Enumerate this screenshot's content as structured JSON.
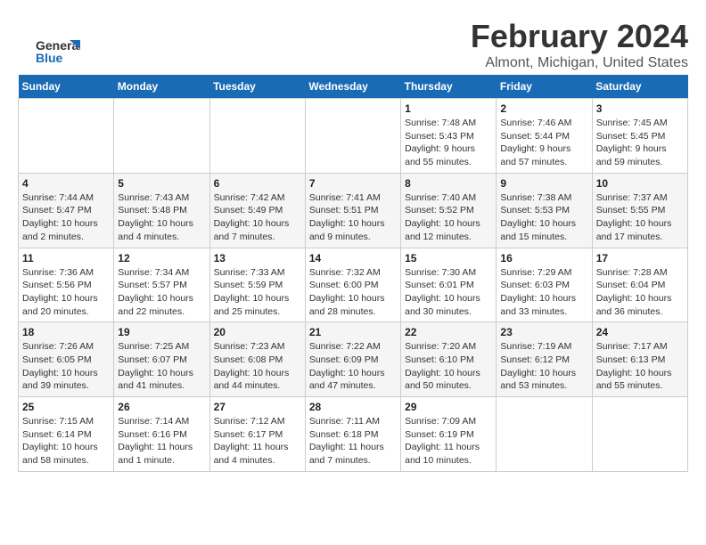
{
  "logo": {
    "line1": "General",
    "line2": "Blue"
  },
  "header": {
    "month_year": "February 2024",
    "location": "Almont, Michigan, United States"
  },
  "weekdays": [
    "Sunday",
    "Monday",
    "Tuesday",
    "Wednesday",
    "Thursday",
    "Friday",
    "Saturday"
  ],
  "weeks": [
    {
      "days": [
        {
          "number": "",
          "info": ""
        },
        {
          "number": "",
          "info": ""
        },
        {
          "number": "",
          "info": ""
        },
        {
          "number": "",
          "info": ""
        },
        {
          "number": "1",
          "info": "Sunrise: 7:48 AM\nSunset: 5:43 PM\nDaylight: 9 hours\nand 55 minutes."
        },
        {
          "number": "2",
          "info": "Sunrise: 7:46 AM\nSunset: 5:44 PM\nDaylight: 9 hours\nand 57 minutes."
        },
        {
          "number": "3",
          "info": "Sunrise: 7:45 AM\nSunset: 5:45 PM\nDaylight: 9 hours\nand 59 minutes."
        }
      ]
    },
    {
      "days": [
        {
          "number": "4",
          "info": "Sunrise: 7:44 AM\nSunset: 5:47 PM\nDaylight: 10 hours\nand 2 minutes."
        },
        {
          "number": "5",
          "info": "Sunrise: 7:43 AM\nSunset: 5:48 PM\nDaylight: 10 hours\nand 4 minutes."
        },
        {
          "number": "6",
          "info": "Sunrise: 7:42 AM\nSunset: 5:49 PM\nDaylight: 10 hours\nand 7 minutes."
        },
        {
          "number": "7",
          "info": "Sunrise: 7:41 AM\nSunset: 5:51 PM\nDaylight: 10 hours\nand 9 minutes."
        },
        {
          "number": "8",
          "info": "Sunrise: 7:40 AM\nSunset: 5:52 PM\nDaylight: 10 hours\nand 12 minutes."
        },
        {
          "number": "9",
          "info": "Sunrise: 7:38 AM\nSunset: 5:53 PM\nDaylight: 10 hours\nand 15 minutes."
        },
        {
          "number": "10",
          "info": "Sunrise: 7:37 AM\nSunset: 5:55 PM\nDaylight: 10 hours\nand 17 minutes."
        }
      ]
    },
    {
      "days": [
        {
          "number": "11",
          "info": "Sunrise: 7:36 AM\nSunset: 5:56 PM\nDaylight: 10 hours\nand 20 minutes."
        },
        {
          "number": "12",
          "info": "Sunrise: 7:34 AM\nSunset: 5:57 PM\nDaylight: 10 hours\nand 22 minutes."
        },
        {
          "number": "13",
          "info": "Sunrise: 7:33 AM\nSunset: 5:59 PM\nDaylight: 10 hours\nand 25 minutes."
        },
        {
          "number": "14",
          "info": "Sunrise: 7:32 AM\nSunset: 6:00 PM\nDaylight: 10 hours\nand 28 minutes."
        },
        {
          "number": "15",
          "info": "Sunrise: 7:30 AM\nSunset: 6:01 PM\nDaylight: 10 hours\nand 30 minutes."
        },
        {
          "number": "16",
          "info": "Sunrise: 7:29 AM\nSunset: 6:03 PM\nDaylight: 10 hours\nand 33 minutes."
        },
        {
          "number": "17",
          "info": "Sunrise: 7:28 AM\nSunset: 6:04 PM\nDaylight: 10 hours\nand 36 minutes."
        }
      ]
    },
    {
      "days": [
        {
          "number": "18",
          "info": "Sunrise: 7:26 AM\nSunset: 6:05 PM\nDaylight: 10 hours\nand 39 minutes."
        },
        {
          "number": "19",
          "info": "Sunrise: 7:25 AM\nSunset: 6:07 PM\nDaylight: 10 hours\nand 41 minutes."
        },
        {
          "number": "20",
          "info": "Sunrise: 7:23 AM\nSunset: 6:08 PM\nDaylight: 10 hours\nand 44 minutes."
        },
        {
          "number": "21",
          "info": "Sunrise: 7:22 AM\nSunset: 6:09 PM\nDaylight: 10 hours\nand 47 minutes."
        },
        {
          "number": "22",
          "info": "Sunrise: 7:20 AM\nSunset: 6:10 PM\nDaylight: 10 hours\nand 50 minutes."
        },
        {
          "number": "23",
          "info": "Sunrise: 7:19 AM\nSunset: 6:12 PM\nDaylight: 10 hours\nand 53 minutes."
        },
        {
          "number": "24",
          "info": "Sunrise: 7:17 AM\nSunset: 6:13 PM\nDaylight: 10 hours\nand 55 minutes."
        }
      ]
    },
    {
      "days": [
        {
          "number": "25",
          "info": "Sunrise: 7:15 AM\nSunset: 6:14 PM\nDaylight: 10 hours\nand 58 minutes."
        },
        {
          "number": "26",
          "info": "Sunrise: 7:14 AM\nSunset: 6:16 PM\nDaylight: 11 hours\nand 1 minute."
        },
        {
          "number": "27",
          "info": "Sunrise: 7:12 AM\nSunset: 6:17 PM\nDaylight: 11 hours\nand 4 minutes."
        },
        {
          "number": "28",
          "info": "Sunrise: 7:11 AM\nSunset: 6:18 PM\nDaylight: 11 hours\nand 7 minutes."
        },
        {
          "number": "29",
          "info": "Sunrise: 7:09 AM\nSunset: 6:19 PM\nDaylight: 11 hours\nand 10 minutes."
        },
        {
          "number": "",
          "info": ""
        },
        {
          "number": "",
          "info": ""
        }
      ]
    }
  ]
}
